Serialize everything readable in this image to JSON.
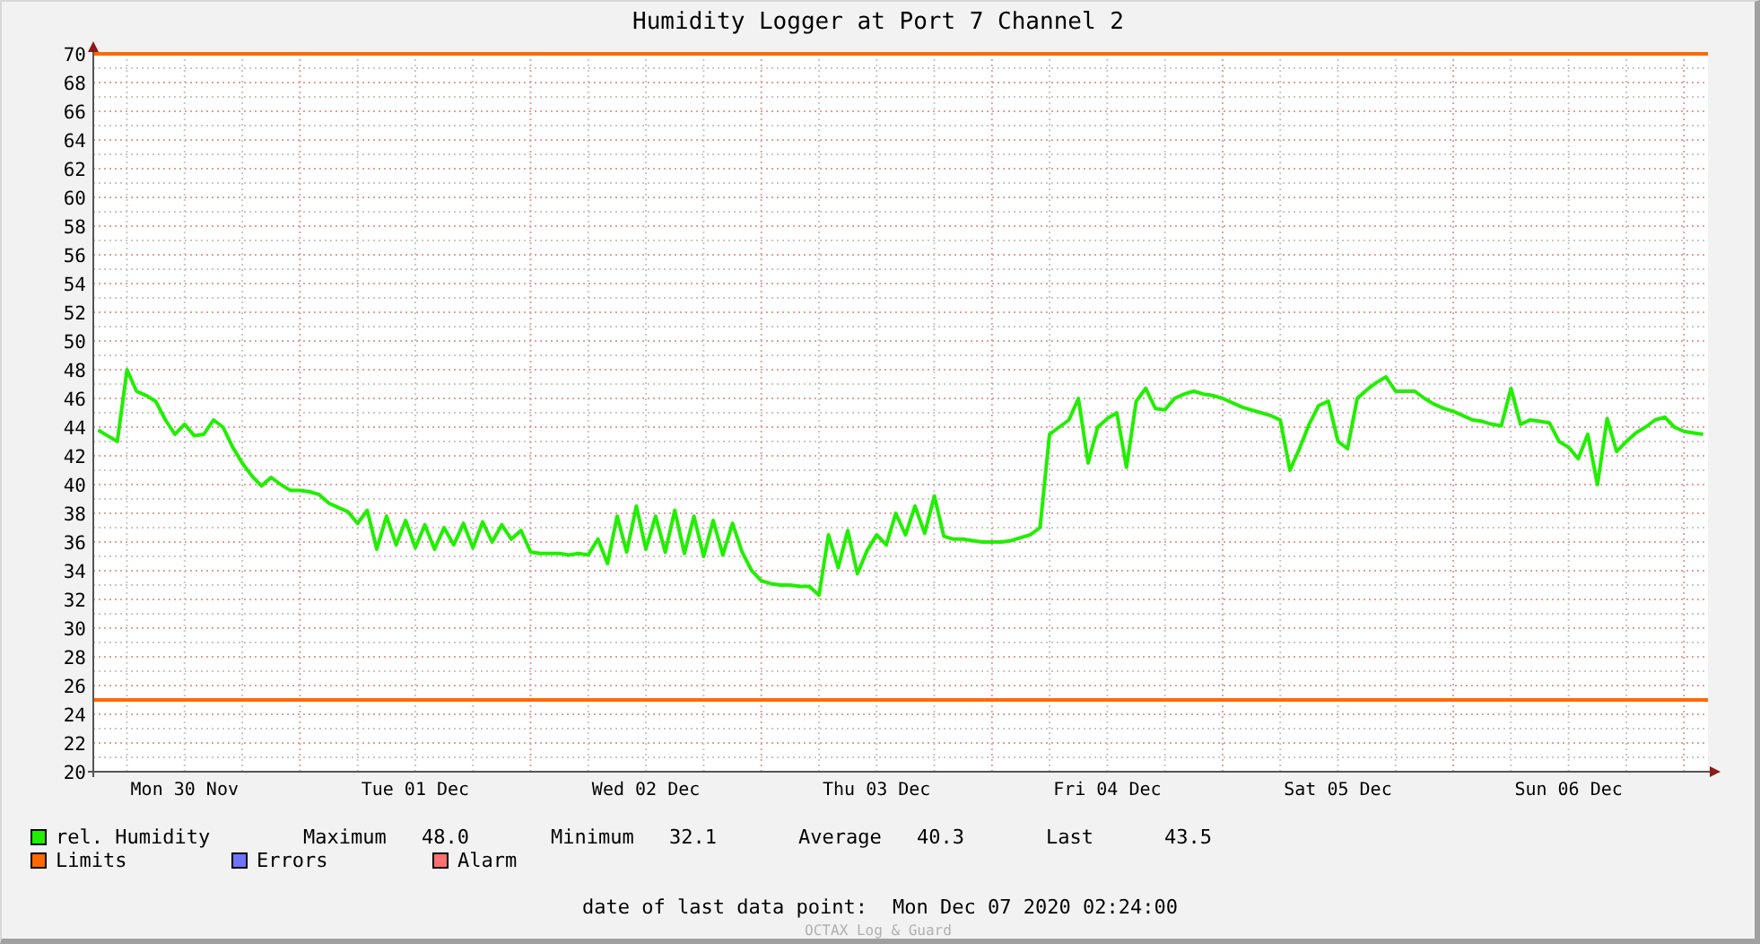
{
  "title": "Humidity Logger at Port 7 Channel 2",
  "graph": {
    "chart_data": {
      "type": "line",
      "ylim": [
        20,
        70
      ],
      "yticks": [
        20,
        22,
        24,
        26,
        28,
        30,
        32,
        34,
        36,
        38,
        40,
        42,
        44,
        46,
        48,
        50,
        52,
        54,
        56,
        58,
        60,
        62,
        64,
        66,
        68,
        70
      ],
      "categories": [
        null,
        null,
        null,
        null,
        null,
        null,
        null,
        null,
        null,
        "Mon 30 Nov",
        null,
        null,
        null,
        null,
        null,
        null,
        null,
        null,
        null,
        null,
        null,
        null,
        null,
        null,
        null,
        null,
        null,
        null,
        null,
        null,
        null,
        null,
        null,
        "Tue 01 Dec",
        null,
        null,
        null,
        null,
        null,
        null,
        null,
        null,
        null,
        null,
        null,
        null,
        null,
        null,
        null,
        null,
        null,
        null,
        null,
        null,
        null,
        null,
        null,
        "Wed 02 Dec",
        null,
        null,
        null,
        null,
        null,
        null,
        null,
        null,
        null,
        null,
        null,
        null,
        null,
        null,
        null,
        null,
        null,
        null,
        null,
        null,
        null,
        null,
        null,
        "Thu 03 Dec",
        null,
        null,
        null,
        null,
        null,
        null,
        null,
        null,
        null,
        null,
        null,
        null,
        null,
        null,
        null,
        null,
        null,
        null,
        null,
        null,
        null,
        null,
        null,
        "Fri 04 Dec",
        null,
        null,
        null,
        null,
        null,
        null,
        null,
        null,
        null,
        null,
        null,
        null,
        null,
        null,
        null,
        null,
        null,
        null,
        null,
        null,
        null,
        null,
        null,
        "Sat 05 Dec",
        null,
        null,
        null,
        null,
        null,
        null,
        null,
        null,
        null,
        null,
        null,
        null,
        null,
        null,
        null,
        null,
        null,
        null,
        null,
        null,
        null,
        null,
        null,
        "Sun 06 Dec",
        null,
        null,
        null,
        null,
        null,
        null,
        null,
        null,
        null,
        null,
        null,
        null,
        null,
        null
      ],
      "series": [
        {
          "name": "rel. Humidity",
          "color": "#22ee00",
          "values": [
            43.8,
            43.4,
            43.0,
            48,
            46.5,
            46.2,
            45.8,
            44.5,
            43.5,
            44.2,
            43.4,
            43.5,
            44.5,
            44,
            42.6,
            41.5,
            40.6,
            39.9,
            40.5,
            40,
            39.6,
            39.6,
            39.5,
            39.3,
            38.7,
            38.4,
            38.1,
            37.3,
            38.2,
            35.5,
            37.8,
            35.8,
            37.5,
            35.6,
            37.2,
            35.5,
            37,
            35.8,
            37.3,
            35.6,
            37.4,
            36,
            37.2,
            36.2,
            36.8,
            35.3,
            35.2,
            35.2,
            35.2,
            35.1,
            35.2,
            35.1,
            36.2,
            34.5,
            37.8,
            35.3,
            38.5,
            35.5,
            37.8,
            35.3,
            38.2,
            35.2,
            37.8,
            35,
            37.5,
            35.1,
            37.3,
            35.3,
            34,
            33.3,
            33.1,
            33,
            33,
            32.9,
            32.9,
            32.3,
            36.5,
            34.2,
            36.8,
            33.8,
            35.4,
            36.5,
            35.8,
            38,
            36.5,
            38.5,
            36.6,
            39.2,
            36.4,
            36.2,
            36.2,
            36.1,
            36,
            36,
            36,
            36.1,
            36.3,
            36.5,
            37,
            43.5,
            44,
            44.5,
            46,
            41.5,
            44,
            44.6,
            45,
            41.2,
            45.8,
            46.7,
            45.3,
            45.2,
            46,
            46.3,
            46.5,
            46.3,
            46.2,
            46,
            45.7,
            45.4,
            45.2,
            45,
            44.8,
            44.5,
            41,
            42.5,
            44.2,
            45.5,
            45.8,
            43,
            42.5,
            46,
            46.6,
            47.1,
            47.5,
            46.5,
            46.5,
            46.5,
            46,
            45.6,
            45.3,
            45.1,
            44.8,
            44.5,
            44.4,
            44.2,
            44.1,
            46.7,
            44.2,
            44.5,
            44.4,
            44.3,
            43,
            42.6,
            41.8,
            43.5,
            40,
            44.6,
            42.3,
            43,
            43.6,
            44,
            44.5,
            44.7,
            44,
            43.7,
            43.6,
            43.5
          ]
        }
      ],
      "grid": true,
      "ref_lines": [
        {
          "axis": "y",
          "value": 70,
          "color": "#ff6a00"
        },
        {
          "axis": "y",
          "value": 25,
          "color": "#ff6a00"
        }
      ]
    }
  },
  "legend": [
    {
      "label": "Limits",
      "color": "#ff6a00"
    },
    {
      "label": "Errors",
      "color": "#6f74ff"
    },
    {
      "label": "Alarm",
      "color": "#ff7070"
    }
  ],
  "stats": [
    {
      "label": "Maximum",
      "value": "48.0"
    },
    {
      "label": "Minimum",
      "value": "32.1"
    },
    {
      "label": "Average",
      "value": "40.3"
    },
    {
      "label": "Last",
      "value": "43.5"
    }
  ],
  "footer": {
    "label": "date of last data point:",
    "value": "Mon Dec 07 2020 02:24:00",
    "credit": "OCTAX Log & Guard"
  }
}
